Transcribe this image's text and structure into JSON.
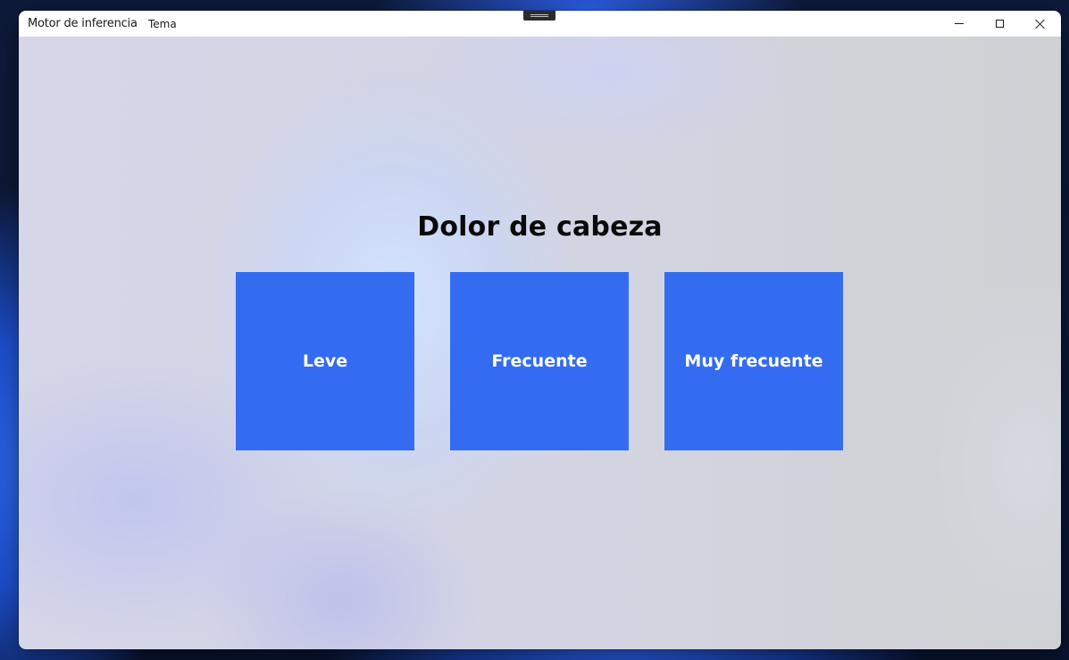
{
  "window": {
    "title": "Motor de inferencia",
    "menu": {
      "tema_label": "Tema"
    },
    "caption_buttons": {
      "minimize_icon": "minimize-icon",
      "maximize_icon": "maximize-icon",
      "close_icon": "close-icon"
    }
  },
  "main": {
    "question": "Dolor de cabeza",
    "options": [
      {
        "label": "Leve"
      },
      {
        "label": "Frecuente"
      },
      {
        "label": "Muy frecuente"
      }
    ],
    "option_color": "#336CF0",
    "option_text_color": "#FFFFFF"
  }
}
